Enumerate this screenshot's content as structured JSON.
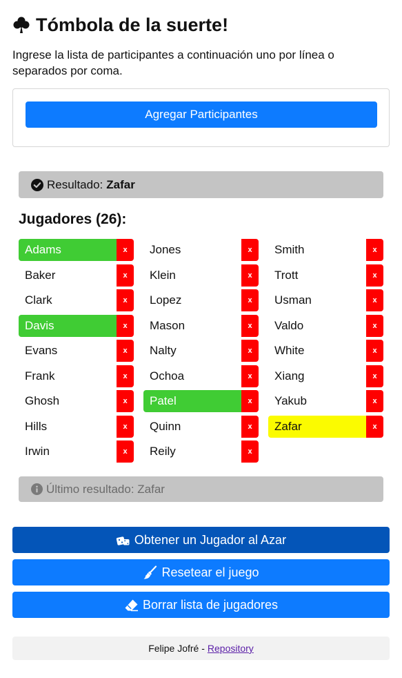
{
  "header": {
    "title": "Tómbola de la suerte!",
    "instructions": "Ingrese la lista de participantes a continuación uno por línea o separados por coma."
  },
  "add_button": {
    "label": "Agregar Participantes"
  },
  "result": {
    "prefix": "Resultado:",
    "winner": "Zafar"
  },
  "players": {
    "heading": "Jugadores (26):",
    "remove_label": "x",
    "columns": [
      [
        {
          "name": "Adams",
          "state": "selected"
        },
        {
          "name": "Baker",
          "state": "normal"
        },
        {
          "name": "Clark",
          "state": "normal"
        },
        {
          "name": "Davis",
          "state": "selected"
        },
        {
          "name": "Evans",
          "state": "normal"
        },
        {
          "name": "Frank",
          "state": "normal"
        },
        {
          "name": "Ghosh",
          "state": "normal"
        },
        {
          "name": "Hills",
          "state": "normal"
        },
        {
          "name": "Irwin",
          "state": "normal"
        }
      ],
      [
        {
          "name": "Jones",
          "state": "normal"
        },
        {
          "name": "Klein",
          "state": "normal"
        },
        {
          "name": "Lopez",
          "state": "normal"
        },
        {
          "name": "Mason",
          "state": "normal"
        },
        {
          "name": "Nalty",
          "state": "normal"
        },
        {
          "name": "Ochoa",
          "state": "normal"
        },
        {
          "name": "Patel",
          "state": "selected"
        },
        {
          "name": "Quinn",
          "state": "normal"
        },
        {
          "name": "Reily",
          "state": "normal"
        }
      ],
      [
        {
          "name": "Smith",
          "state": "normal"
        },
        {
          "name": "Trott",
          "state": "normal"
        },
        {
          "name": "Usman",
          "state": "normal"
        },
        {
          "name": "Valdo",
          "state": "normal"
        },
        {
          "name": "White",
          "state": "normal"
        },
        {
          "name": "Xiang",
          "state": "normal"
        },
        {
          "name": "Yakub",
          "state": "normal"
        },
        {
          "name": "Zafar",
          "state": "current"
        }
      ]
    ]
  },
  "last_result": {
    "text": "Último resultado: Zafar"
  },
  "actions": {
    "random_label": "Obtener un Jugador al Azar",
    "reset_label": "Resetear el juego",
    "clear_label": "Borrar lista de jugadores"
  },
  "footer": {
    "author": "Felipe Jofré -",
    "link_label": "Repository"
  },
  "colors": {
    "primary": "#0d7bff",
    "primary_active": "#0455b8",
    "selected": "#40cc34",
    "current": "#fbfb00",
    "remove": "#ff0000",
    "result_bg": "#c4c4c4"
  },
  "icons": {
    "title": "clover-icon",
    "result": "check-circle-icon",
    "last_result": "info-circle-icon",
    "random": "dice-icon",
    "reset": "broom-icon",
    "clear": "eraser-icon"
  }
}
